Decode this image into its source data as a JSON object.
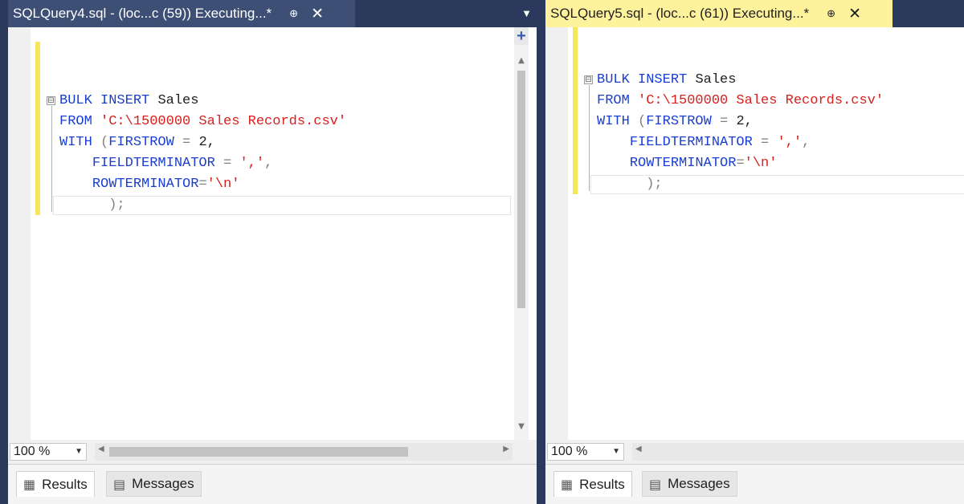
{
  "left": {
    "tab_title": "SQLQuery4.sql - (loc...c (59)) Executing...*",
    "pin_glyph": "⊕",
    "close_glyph": "✕",
    "zoom": "100 %",
    "results_label": "Results",
    "messages_label": "Messages"
  },
  "right": {
    "tab_title": "SQLQuery5.sql - (loc...c (61)) Executing...*",
    "pin_glyph": "⊕",
    "close_glyph": "✕",
    "zoom": "100 %",
    "results_label": "Results",
    "messages_label": "Messages"
  },
  "code": {
    "kw_bulk": "BULK",
    "kw_insert": "INSERT",
    "table": "Sales",
    "kw_from": "FROM",
    "path": "'C:\\1500000 Sales Records.csv'",
    "kw_with": "WITH",
    "paren_open": "(",
    "firstrow": "FIRSTROW",
    "eq": "=",
    "firstrow_val": "2,",
    "fieldterminator": "FIELDTERMINATOR",
    "field_val": "','",
    "comma": ",",
    "rowterminator": "ROWTERMINATOR",
    "row_val": "'\\n'",
    "close": ");"
  },
  "colors": {
    "keyword": "#1a3ed1",
    "string": "#d8201e",
    "active_tab": "#fff29d",
    "inactive_tab": "#3e4f75",
    "frame": "#2b3a5c"
  },
  "icons": {
    "collapse": "⊟",
    "split": "+",
    "up": "▲",
    "down": "▼",
    "left": "◀",
    "right": "▶",
    "dropdown": "▼",
    "results": "▦",
    "messages": "▤"
  }
}
